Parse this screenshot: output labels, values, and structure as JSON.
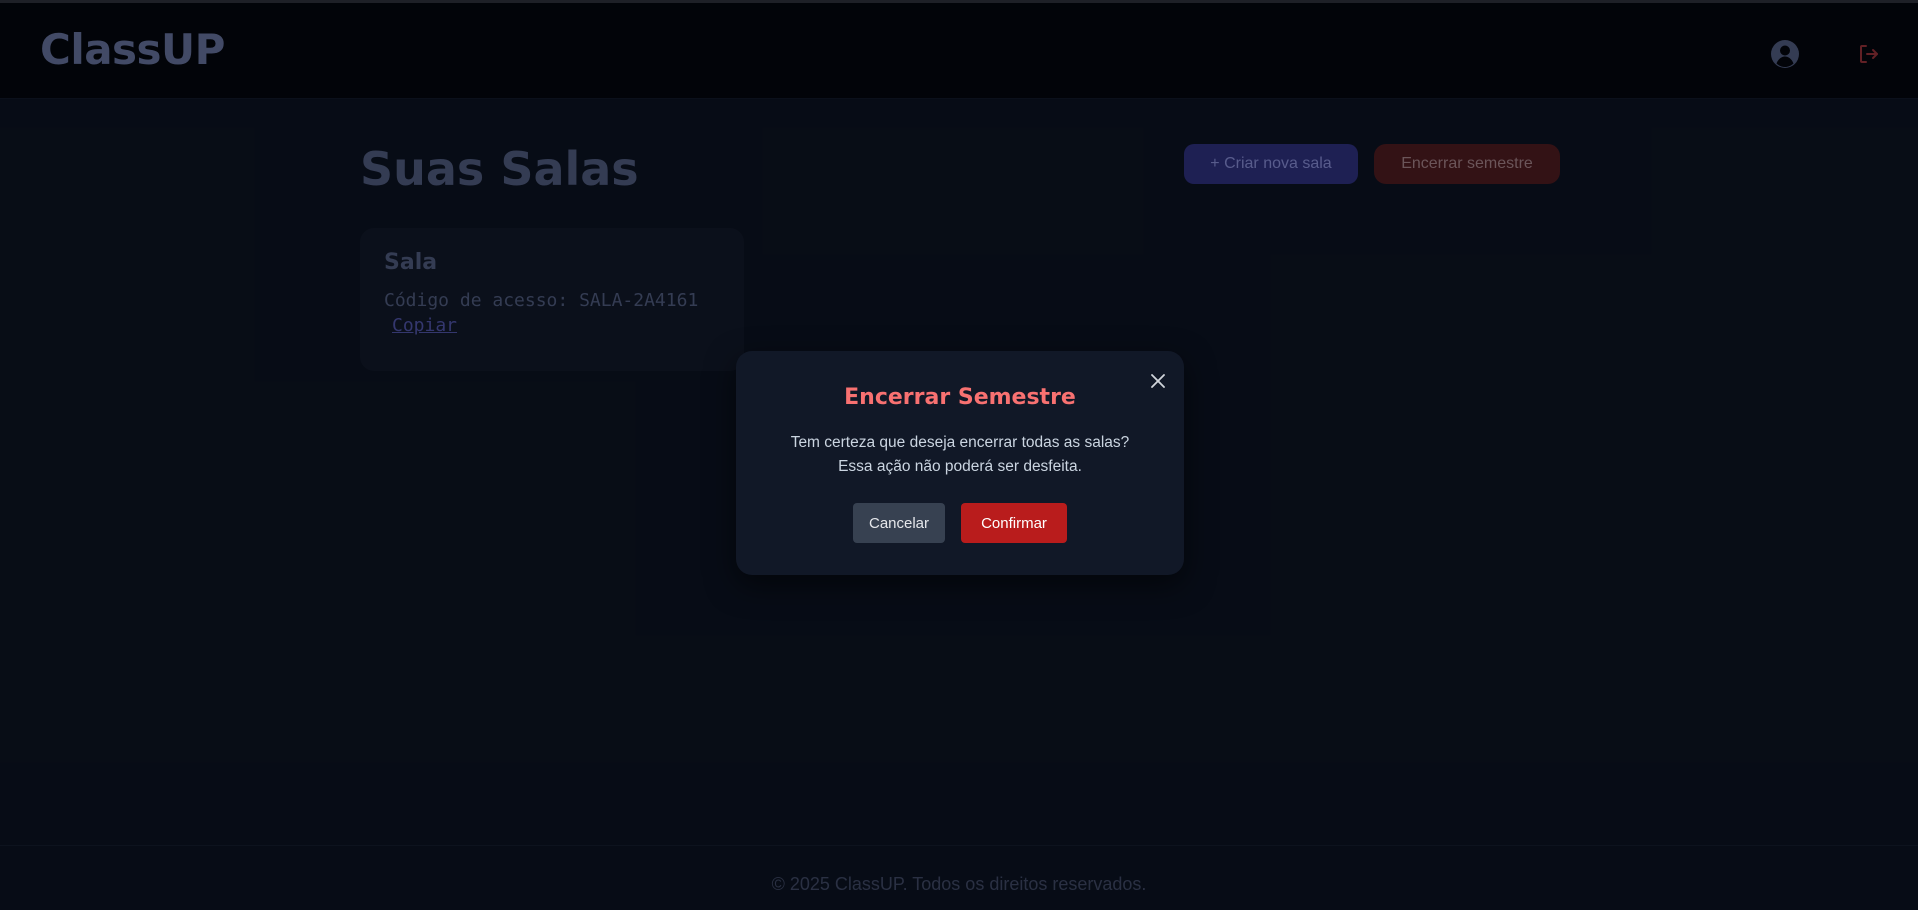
{
  "header": {
    "logo": "ClassUP",
    "user_icon": "user-circle-icon",
    "logout_icon": "logout-icon"
  },
  "main": {
    "title": "Suas Salas",
    "create_button": "+ Criar nova sala",
    "end_semester_button": "Encerrar semestre",
    "rooms": [
      {
        "name": "Sala",
        "access_code_label": "Código de acesso:",
        "access_code": "SALA-2A4161",
        "copy_label": "Copiar"
      }
    ]
  },
  "modal": {
    "title": "Encerrar Semestre",
    "message": "Tem certeza que deseja encerrar todas as salas? Essa ação não poderá ser desfeita.",
    "cancel_label": "Cancelar",
    "confirm_label": "Confirmar",
    "close_icon": "close-icon"
  },
  "footer": {
    "text": "© 2025 ClassUP. Todos os direitos reservados."
  },
  "colors": {
    "danger": "#f87171",
    "confirm_button": "#b91c1c",
    "cancel_button": "#374151",
    "create_button": "#2b2e78",
    "end_button": "#4a1a1f"
  }
}
